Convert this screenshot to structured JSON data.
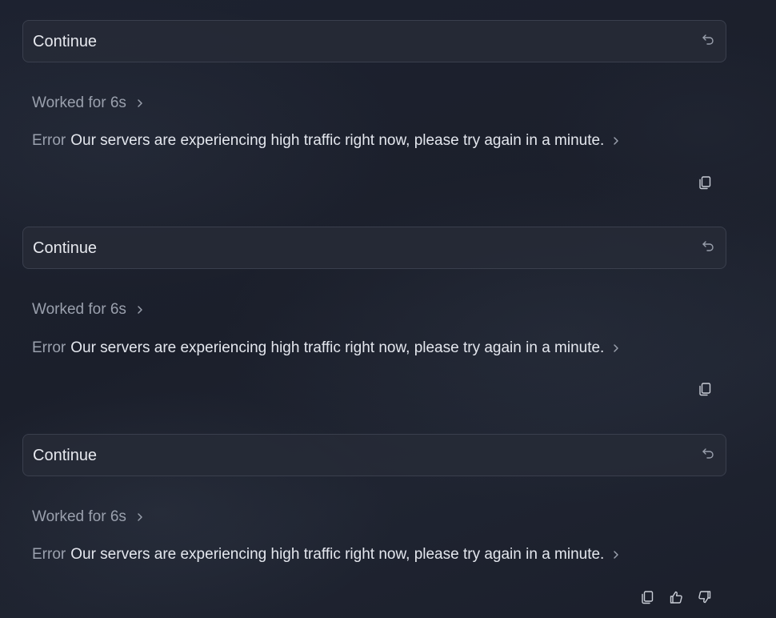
{
  "colors": {
    "background": "#1c202c",
    "card_bg": "#262a36",
    "card_border": "#3a3f4d",
    "text_primary": "#e4e7ee",
    "text_muted": "#9aa0ad"
  },
  "turns": [
    {
      "prompt": "Continue",
      "worked": "Worked for 6s",
      "error_label": "Error",
      "error_message": "Our servers are experiencing high traffic right now, please try again in a minute.",
      "actions": [
        "copy-icon"
      ]
    },
    {
      "prompt": "Continue",
      "worked": "Worked for 6s",
      "error_label": "Error",
      "error_message": "Our servers are experiencing high traffic right now, please try again in a minute.",
      "actions": [
        "copy-icon"
      ]
    },
    {
      "prompt": "Continue",
      "worked": "Worked for 6s",
      "error_label": "Error",
      "error_message": "Our servers are experiencing high traffic right now, please try again in a minute.",
      "actions": [
        "copy-icon",
        "thumbs-up-icon",
        "thumbs-down-icon"
      ]
    }
  ]
}
